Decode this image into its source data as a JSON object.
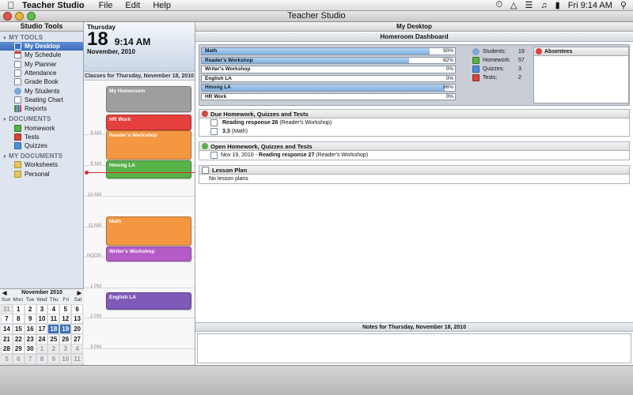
{
  "menubar": {
    "app_name": "Teacher Studio",
    "menus": [
      "File",
      "Edit",
      "Help"
    ],
    "clock": "Fri 9:14 AM"
  },
  "window": {
    "title": "Teacher Studio"
  },
  "sidebar": {
    "header": "Studio Tools",
    "sections": [
      {
        "title": "MY TOOLS",
        "items": [
          "My Desktop",
          "My Schedule",
          "My Planner",
          "Attendance",
          "Grade Book",
          "My Students",
          "Seating Chart",
          "Reports"
        ]
      },
      {
        "title": "DOCUMENTS",
        "items": [
          "Homework",
          "Tests",
          "Quizzes"
        ]
      },
      {
        "title": "MY DOCUMENTS",
        "items": [
          "Worksheets",
          "Personal"
        ]
      }
    ],
    "selected": "My Desktop"
  },
  "minical": {
    "month": "November 2010",
    "prev": "◀",
    "next": "▶",
    "dows": [
      "Sun",
      "Mon",
      "Tue",
      "Wed",
      "Thu",
      "Fri",
      "Sat"
    ],
    "weeks": [
      [
        "31",
        "1",
        "2",
        "3",
        "4",
        "5",
        "6"
      ],
      [
        "7",
        "8",
        "9",
        "10",
        "11",
        "12",
        "13"
      ],
      [
        "14",
        "15",
        "16",
        "17",
        "18",
        "19",
        "20"
      ],
      [
        "21",
        "22",
        "23",
        "24",
        "25",
        "26",
        "27"
      ],
      [
        "28",
        "29",
        "30",
        "1",
        "2",
        "3",
        "4"
      ],
      [
        "5",
        "6",
        "7",
        "8",
        "9",
        "10",
        "11"
      ]
    ]
  },
  "day": {
    "dow": "Thursday",
    "date": "18",
    "time": "9:14 AM",
    "month": "November, 2010",
    "classes_title": "Classes for Thursday, November 18, 2010",
    "hours": [
      "8 AM",
      "9 AM",
      "10 AM",
      "11 AM",
      "NOON",
      "1 PM",
      "2 PM",
      "3 PM"
    ],
    "events": [
      {
        "name": "My Homeroom",
        "color": "#9e9e9e"
      },
      {
        "name": "HR Work",
        "color": "#e5403d"
      },
      {
        "name": "Reader's Workshop",
        "color": "#f59641"
      },
      {
        "name": "Hmong LA",
        "color": "#57b248"
      },
      {
        "name": "Math",
        "color": "#f59641"
      },
      {
        "name": "Writer's Workshop",
        "color": "#b55bc8"
      },
      {
        "name": "English LA",
        "color": "#7f5ab9"
      }
    ]
  },
  "main": {
    "title": "My Desktop",
    "dashboard_title": "Homeroom Dashboard",
    "progress": [
      {
        "name": "Math",
        "pct": 90,
        "label": "90%"
      },
      {
        "name": "Reader's Workshop",
        "pct": 82,
        "label": "82%"
      },
      {
        "name": "Writer's Workshop",
        "pct": 0,
        "label": "0%"
      },
      {
        "name": "English LA",
        "pct": 0,
        "label": "0%"
      },
      {
        "name": "Hmong LA",
        "pct": 96,
        "label": "96%"
      },
      {
        "name": "HR Work",
        "pct": 0,
        "label": "0%"
      }
    ],
    "stats": [
      {
        "label": "Students:",
        "value": "19"
      },
      {
        "label": "Homework:",
        "value": "57"
      },
      {
        "label": "Quizzes:",
        "value": "3"
      },
      {
        "label": "Tests:",
        "value": "2"
      }
    ],
    "absentees_title": "Absentees",
    "due": {
      "title": "Due Homework, Quizzes and Tests",
      "items": [
        {
          "bold": "Reading response 26",
          "rest": "(Reader's Workshop)"
        },
        {
          "bold": "3.3",
          "rest": "(Math)"
        }
      ]
    },
    "open": {
      "title": "Open Homework, Quizzes and Tests",
      "items": [
        {
          "prefix": "Nov 19, 2010 -",
          "bold": "Reading response 27",
          "rest": "(Reader's Workshop)"
        }
      ]
    },
    "lesson": {
      "title": "Lesson Plan",
      "text": "No lesson plans"
    },
    "notes_title": "Notes for Thursday, November 18, 2010"
  },
  "colors": {
    "accent": "#3d6fb6",
    "absent": "#d8453c",
    "open": "#5cb04a",
    "due": "#d8453c"
  }
}
